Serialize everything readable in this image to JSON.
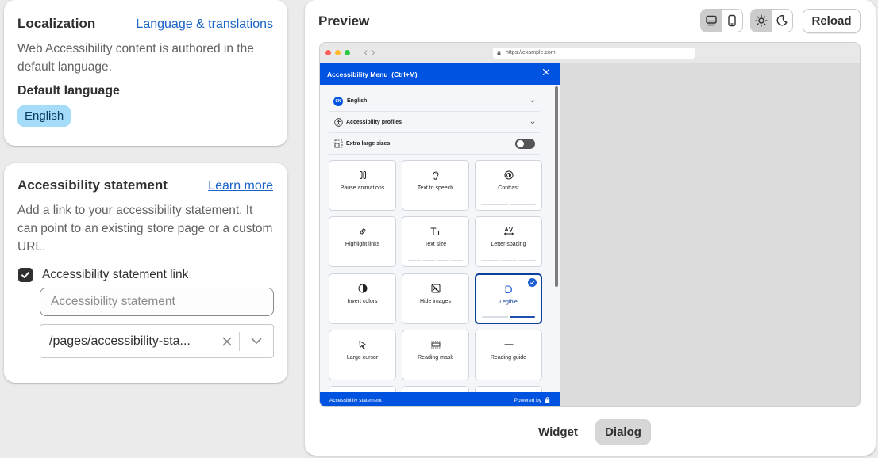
{
  "localization": {
    "title": "Localization",
    "link": "Language & translations",
    "description": "Web Accessibility content is authored in the default language.",
    "default_language_label": "Default language",
    "language_badge": "English"
  },
  "statement": {
    "title": "Accessibility statement",
    "link": "Learn more",
    "description": "Add a link to your accessibility statement. It can point to an existing store page or a custom URL.",
    "checkbox_label": "Accessibility statement link",
    "checkbox_checked": true,
    "input_placeholder": "Accessibility statement",
    "url_value": "/pages/accessibility-sta..."
  },
  "preview": {
    "title": "Preview",
    "reload_label": "Reload",
    "device_active": "desktop",
    "theme_active": "light",
    "browser_url": "https://example.com",
    "menu": {
      "header": "Accessibility Menu  (Ctrl+M)",
      "language": "English",
      "language_code": "EN",
      "profiles": "Accessibility profiles",
      "extra_large": "Extra large sizes",
      "tiles": [
        "Pause animations",
        "Text to speech",
        "Contrast",
        "Highlight links",
        "Text size",
        "Letter spacing",
        "Invert colors",
        "Hide images",
        "Legible",
        "Large cursor",
        "Reading mask",
        "Reading guide"
      ],
      "footer_left": "Accessibility statement",
      "footer_right": "Powered by"
    },
    "view_widget": "Widget",
    "view_dialog": "Dialog",
    "view_active": "Dialog"
  },
  "colors": {
    "accent": "#0052e0",
    "badge": "#a4dcfa",
    "link": "#1a64c8"
  }
}
